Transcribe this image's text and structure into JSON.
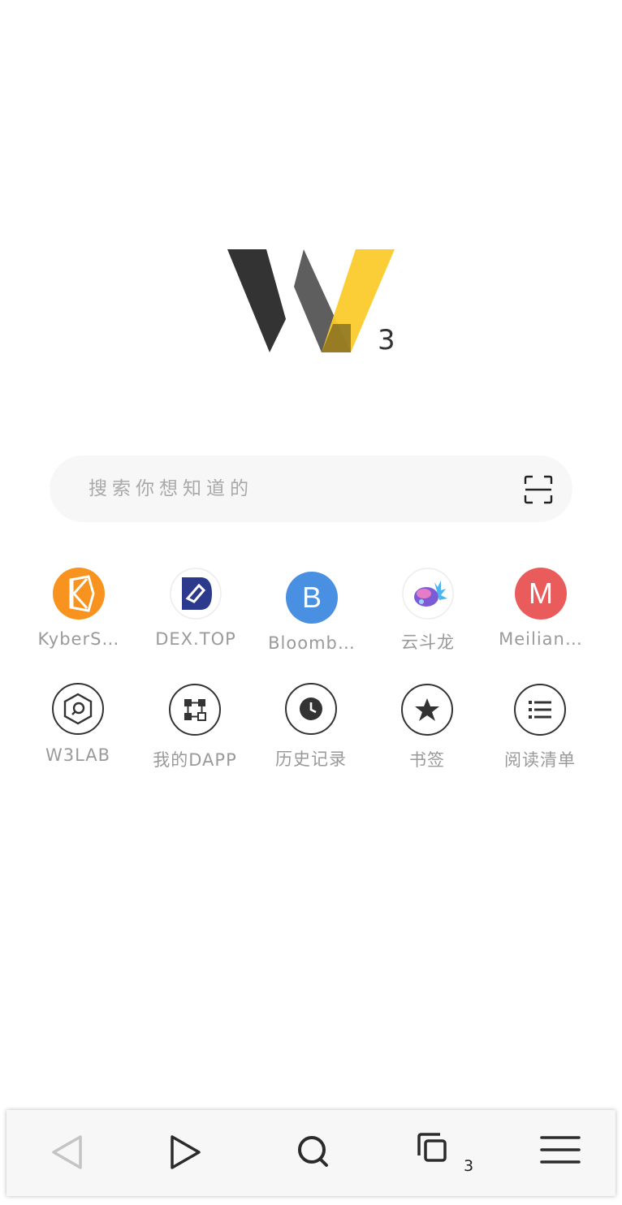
{
  "logo": {
    "superscript": "3"
  },
  "search": {
    "placeholder": "搜索你想知道的"
  },
  "shortcuts": [
    {
      "label": "KyberS…",
      "icon": "kyberswap-icon",
      "color": "#f7931e"
    },
    {
      "label": "DEX.TOP",
      "icon": "dextop-icon",
      "color": "#2b3a8c"
    },
    {
      "label": "Bloomb…",
      "icon": "bloomberg-b-icon",
      "color": "#4a90e2",
      "letter": "B"
    },
    {
      "label": "云斗龙",
      "icon": "dragon-egg-icon",
      "color": "#7b5cd6"
    },
    {
      "label": "Meilian…",
      "icon": "meilian-m-icon",
      "color": "#ea5c5c",
      "letter": "M"
    }
  ],
  "tools": [
    {
      "label": "W3LAB",
      "icon": "w3lab-hexagon-icon"
    },
    {
      "label": "我的DAPP",
      "icon": "dapp-grid-icon"
    },
    {
      "label": "历史记录",
      "icon": "clock-icon"
    },
    {
      "label": "书签",
      "icon": "star-icon"
    },
    {
      "label": "阅读清单",
      "icon": "list-icon"
    }
  ],
  "bottom_nav": {
    "tab_count": "3",
    "items": [
      "back-icon",
      "forward-icon",
      "search-icon",
      "tabs-icon",
      "menu-icon"
    ]
  },
  "colors": {
    "logo_dark": "#333333",
    "logo_gray": "#5e5e5e",
    "logo_yellow": "#fbcb2c"
  }
}
